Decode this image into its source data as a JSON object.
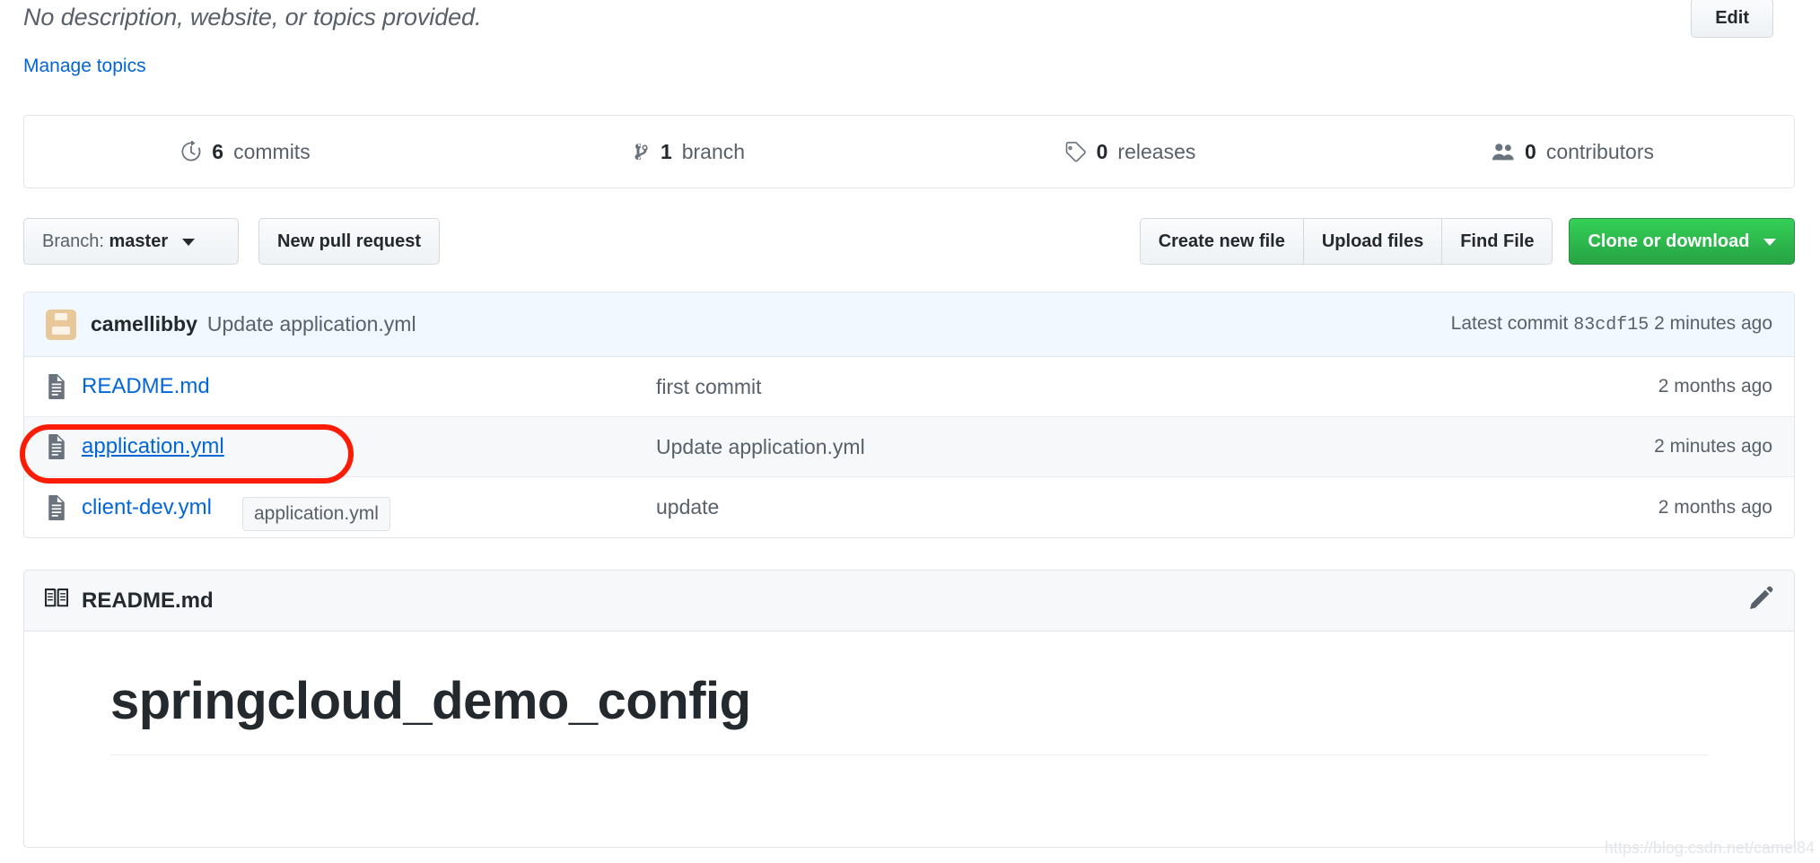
{
  "header": {
    "description": "No description, website, or topics provided.",
    "manage_topics_label": "Manage topics",
    "edit_label": "Edit"
  },
  "stats": [
    {
      "icon": "history-icon",
      "count": "6",
      "label": "commits"
    },
    {
      "icon": "branch-icon",
      "count": "1",
      "label": "branch"
    },
    {
      "icon": "tag-icon",
      "count": "0",
      "label": "releases"
    },
    {
      "icon": "people-icon",
      "count": "0",
      "label": "contributors"
    }
  ],
  "toolbar": {
    "branch_prefix": "Branch:",
    "branch_name": "master",
    "new_pull_request_label": "New pull request",
    "create_new_file_label": "Create new file",
    "upload_files_label": "Upload files",
    "find_file_label": "Find File",
    "clone_label": "Clone or download"
  },
  "commit_header": {
    "author": "camellibby",
    "message": "Update application.yml",
    "latest_commit_prefix": "Latest commit",
    "sha": "83cdf15",
    "age": "2 minutes ago"
  },
  "files": [
    {
      "name": "README.md",
      "message": "first commit",
      "age": "2 months ago"
    },
    {
      "name": "application.yml",
      "message": "Update application.yml",
      "age": "2 minutes ago"
    },
    {
      "name": "client-dev.yml",
      "message": "update",
      "age": "2 months ago"
    }
  ],
  "tooltip": {
    "text": "application.yml"
  },
  "readme": {
    "filename": "README.md",
    "heading": "springcloud_demo_config"
  },
  "watermark": {
    "text": "https://blog.csdn.net/camel84"
  },
  "colors": {
    "link": "#0366d6",
    "green_button": "#28a745",
    "annotation": "#fb1c05",
    "muted_text": "#586069",
    "commit_header_bg": "#f1f8ff"
  }
}
